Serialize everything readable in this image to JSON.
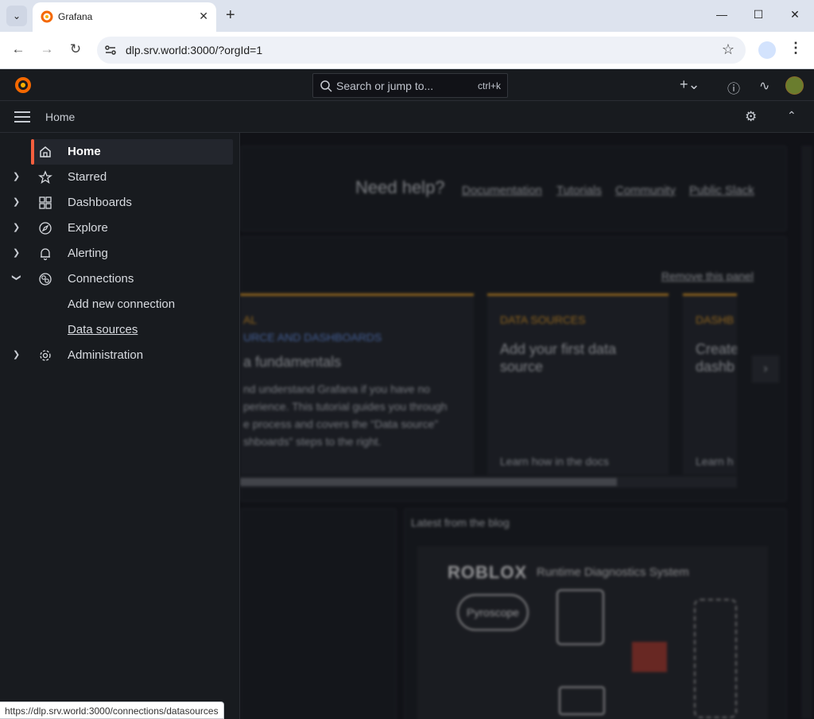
{
  "browser": {
    "tab_title": "Grafana",
    "url": "dlp.srv.world:3000/?orgId=1",
    "status_url": "https://dlp.srv.world:3000/connections/datasources"
  },
  "topnav": {
    "search_placeholder": "Search or jump to...",
    "shortcut": "ctrl+k",
    "breadcrumb": "Home"
  },
  "sidebar": {
    "items": [
      {
        "label": "Home",
        "icon": "home-icon"
      },
      {
        "label": "Starred",
        "icon": "star-icon"
      },
      {
        "label": "Dashboards",
        "icon": "grid-icon"
      },
      {
        "label": "Explore",
        "icon": "compass-icon"
      },
      {
        "label": "Alerting",
        "icon": "bell-icon"
      },
      {
        "label": "Connections",
        "icon": "connections-icon"
      },
      {
        "label": "Administration",
        "icon": "gear-icon"
      }
    ],
    "connections_children": [
      "Add new connection",
      "Data sources"
    ]
  },
  "help": {
    "title": "Need help?",
    "links": [
      "Documentation",
      "Tutorials",
      "Community",
      "Public Slack"
    ]
  },
  "setup": {
    "remove_label": "Remove this panel",
    "card1": {
      "kicker1": "AL",
      "kicker2": "URCE AND DASHBOARDS",
      "title": "a fundamentals",
      "body": [
        "nd understand Grafana if you have no",
        "perience. This tutorial guides you through",
        "e process and covers the “Data source”",
        "shboards” steps to the right."
      ]
    },
    "card2": {
      "kicker": "DATA SOURCES",
      "title": "Add your first data source",
      "foot": "Learn how in the docs"
    },
    "card3": {
      "kicker": "DASHB",
      "title1": "Create",
      "title2": "dashb",
      "foot": "Learn h"
    }
  },
  "blog": {
    "title": "Latest from the blog",
    "brand": "ROBLOX",
    "subtitle": "Runtime Diagnostics System",
    "node": "Pyroscope"
  },
  "colors": {
    "accent": "#f55f3e",
    "card_accent": "#f5a623"
  }
}
